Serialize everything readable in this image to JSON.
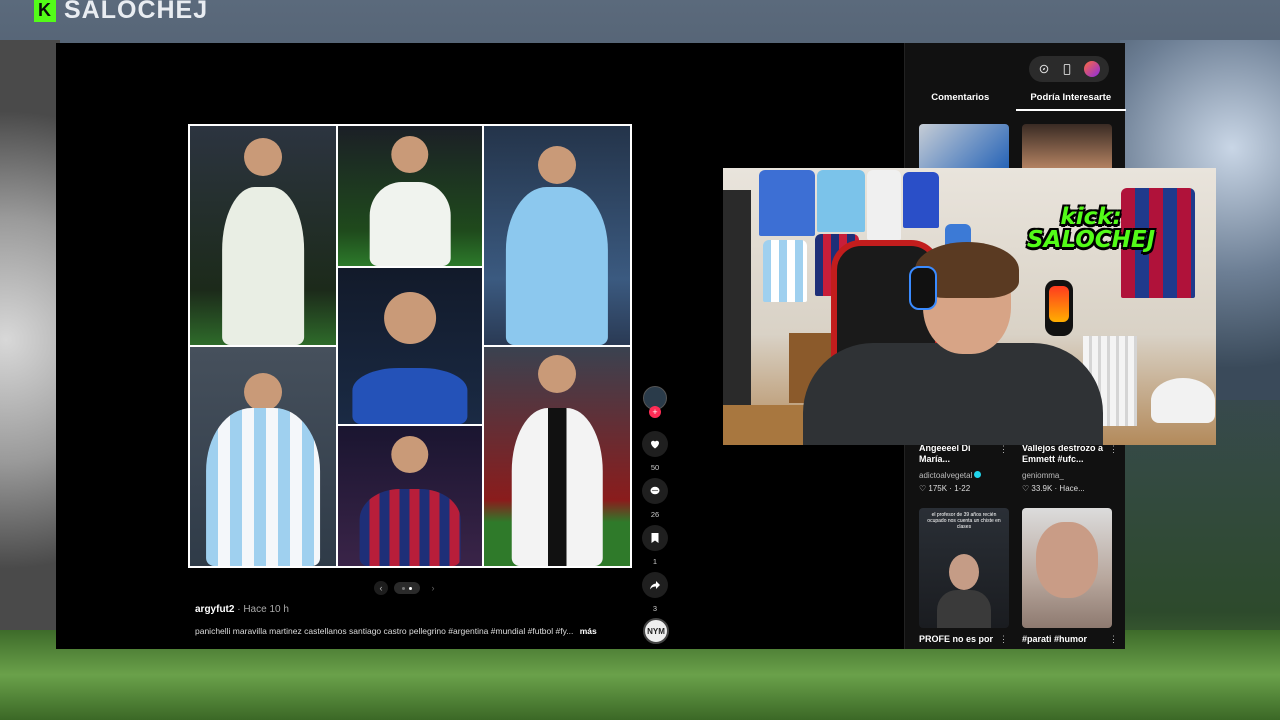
{
  "brand": {
    "logo_letter": "K",
    "name": "SALOCHEJ",
    "accent": "#53fc18"
  },
  "overlay": {
    "kick_line1": "kick:",
    "kick_line2": "SALOCHEJ"
  },
  "post": {
    "author": "argyfut2",
    "time": " · Hace 10 h",
    "caption": "panichelli  maravilla martinez  castellanos santiago castro pellegrino #argentina #mundial #futbol #fy...",
    "more": "más",
    "carousel_prev": "‹",
    "carousel_next": "›"
  },
  "actions": {
    "follow_plus": "+",
    "likes": "50",
    "comments": "26",
    "saves": "1",
    "shares": "3",
    "music_disc_label": "NYM"
  },
  "side": {
    "tabs": [
      "Comentarios",
      "Podría Interesarte"
    ],
    "videos": [
      {
        "title": "Angeeeel Di María...",
        "author": "adictoalvegetal",
        "stats": "♡ 175K · 1-22"
      },
      {
        "title": "Vallejos destrozo a Emmett #ufc...",
        "author": "geniomma_",
        "stats": "♡ 33.9K · Hace..."
      },
      {
        "title": "PROFE no es por",
        "author": "",
        "stats": "",
        "thumb_text": "el profesor de 39 años recién ocupado nos cuenta un chiste en clases"
      },
      {
        "title": "#parati #humor",
        "author": "",
        "stats": ""
      }
    ]
  },
  "icons": {
    "heart": "heart-icon",
    "comment": "comment-icon",
    "bookmark": "bookmark-icon",
    "share": "share-icon",
    "compass": "compass-icon",
    "phone": "phone-icon"
  }
}
